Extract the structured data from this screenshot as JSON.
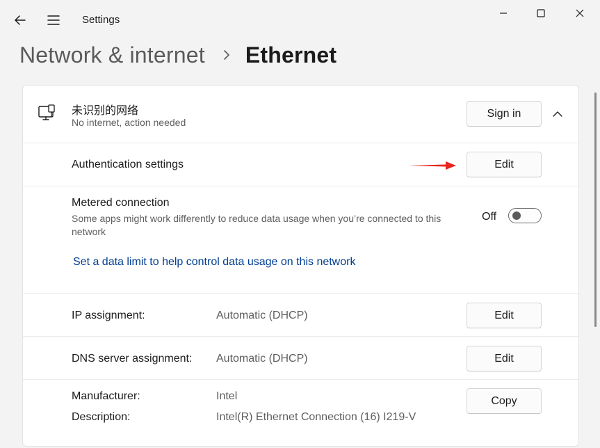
{
  "window": {
    "title": "Settings"
  },
  "breadcrumb": {
    "parent": "Network & internet",
    "current": "Ethernet"
  },
  "network": {
    "name": "未识别的网络",
    "status": "No internet, action needed",
    "sign_in_label": "Sign in"
  },
  "auth": {
    "label": "Authentication settings",
    "edit_label": "Edit"
  },
  "metered": {
    "label": "Metered connection",
    "description": "Some apps might work differently to reduce data usage when you’re connected to this network",
    "toggle_text": "Off",
    "toggle_on": false,
    "link": "Set a data limit to help control data usage on this network"
  },
  "ip": {
    "label": "IP assignment:",
    "value": "Automatic (DHCP)",
    "edit_label": "Edit"
  },
  "dns": {
    "label": "DNS server assignment:",
    "value": "Automatic (DHCP)",
    "edit_label": "Edit"
  },
  "properties": {
    "manufacturer_label": "Manufacturer:",
    "manufacturer_value": "Intel",
    "description_label": "Description:",
    "description_value": "Intel(R) Ethernet Connection (16) I219-V",
    "copy_label": "Copy"
  },
  "colors": {
    "accent_link": "#003e92",
    "annotation_arrow": "#e8261d"
  },
  "icons": {
    "back": "back-arrow-icon",
    "menu": "hamburger-menu-icon",
    "minimize": "minimize-icon",
    "maximize": "maximize-icon",
    "close": "close-icon",
    "network": "ethernet-network-icon",
    "collapse": "chevron-up-icon"
  }
}
